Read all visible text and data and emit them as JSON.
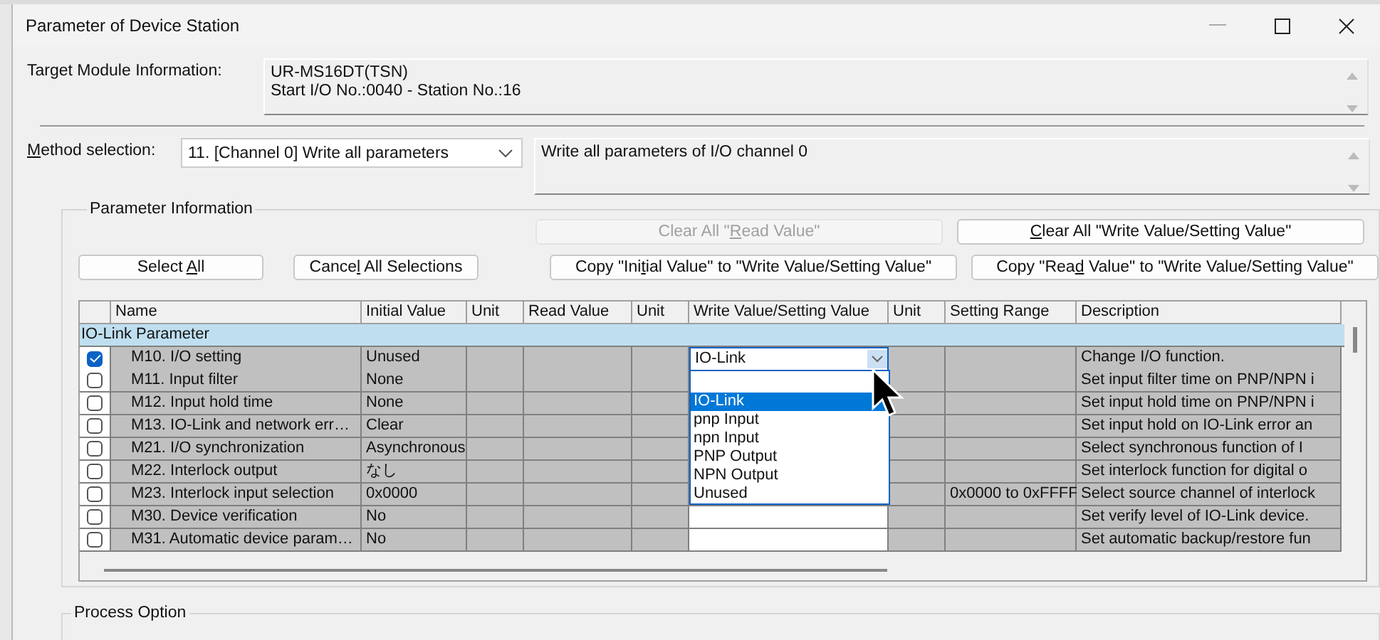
{
  "window": {
    "title": "Parameter of Device Station"
  },
  "target_module": {
    "label": "Target Module Information:",
    "lines": [
      "UR-MS16DT(TSN)",
      "Start I/O No.:0040 - Station No.:16"
    ]
  },
  "method": {
    "label_parts": [
      {
        "text": "M",
        "underlined": true
      },
      {
        "text": "ethod selection:",
        "underlined": false
      }
    ],
    "value": "11. [Channel 0] Write all parameters",
    "description": "Write all parameters of I/O channel 0"
  },
  "parameter_information": {
    "title": "Parameter Information",
    "buttons": [
      {
        "label_parts": [
          {
            "text": "Clear All \"",
            "underlined": false
          },
          {
            "text": "R",
            "underlined": true
          },
          {
            "text": "ead Value\"",
            "underlined": false
          }
        ],
        "disabled": true
      },
      {
        "label_parts": [
          {
            "text": "C",
            "underlined": true
          },
          {
            "text": "lear All \"Write Value/Setting Value\"",
            "underlined": false
          }
        ],
        "disabled": false
      },
      {
        "label_parts": [
          {
            "text": "Select ",
            "underlined": false
          },
          {
            "text": "A",
            "underlined": true
          },
          {
            "text": "ll",
            "underlined": false
          }
        ],
        "disabled": false
      },
      {
        "label_parts": [
          {
            "text": "Cance",
            "underlined": false
          },
          {
            "text": "l",
            "underlined": true
          },
          {
            "text": " All Selections",
            "underlined": false
          }
        ],
        "disabled": false
      },
      {
        "label_parts": [
          {
            "text": "Copy \"Ini",
            "underlined": false
          },
          {
            "text": "t",
            "underlined": true
          },
          {
            "text": "ial Value\" to \"Write Value/Setting Value\"",
            "underlined": false
          }
        ],
        "disabled": false
      },
      {
        "label_parts": [
          {
            "text": "Copy \"Rea",
            "underlined": false
          },
          {
            "text": "d",
            "underlined": true
          },
          {
            "text": " Value\" to \"Write Value/Setting Value\"",
            "underlined": false
          }
        ],
        "disabled": false
      }
    ],
    "table": {
      "columns": [
        "Name",
        "Initial Value",
        "Unit",
        "Read Value",
        "Unit",
        "Write Value/Setting Value",
        "Unit",
        "Setting Range",
        "Description"
      ],
      "group": "IO-Link Parameter",
      "rows": [
        {
          "checked": true,
          "name": "M10. I/O setting",
          "initial_value": "Unused",
          "write_value": "IO-Link",
          "description": "Change I/O function."
        },
        {
          "checked": false,
          "name": "M11. Input filter",
          "initial_value": "None",
          "description": "Set input filter time on PNP/NPN i"
        },
        {
          "checked": false,
          "name": "M12. Input hold time",
          "initial_value": "None",
          "description": "Set input hold time on PNP/NPN i"
        },
        {
          "checked": false,
          "name": "M13. IO-Link and network err…",
          "initial_value": "Clear",
          "description": "Set input hold on IO-Link error an"
        },
        {
          "checked": false,
          "name": "M21. I/O synchronization",
          "initial_value": "Asynchronous",
          "description": "Select synchronous function of I"
        },
        {
          "checked": false,
          "name": "M22. Interlock output",
          "initial_value": "なし",
          "description": "Set interlock function for digital o"
        },
        {
          "checked": false,
          "name": "M23. Interlock input selection",
          "initial_value": "0x0000",
          "setting_range": "0x0000 to 0xFFFF",
          "description": "Select source channel of interlock"
        },
        {
          "checked": false,
          "name": "M30. Device verification",
          "initial_value": "No",
          "description": "Set verify level of IO-Link device."
        },
        {
          "checked": false,
          "name": "M31. Automatic device param…",
          "initial_value": "No",
          "description": "Set automatic backup/restore fun"
        }
      ],
      "dropdown": {
        "items": [
          {
            "label": "IO-Link",
            "selected": true
          },
          {
            "label": "pnp Input",
            "selected": false
          },
          {
            "label": "npn Input",
            "selected": false
          },
          {
            "label": "PNP Output",
            "selected": false
          },
          {
            "label": "NPN Output",
            "selected": false
          },
          {
            "label": "Unused",
            "selected": false
          }
        ]
      }
    }
  },
  "process_option": {
    "title": "Process Option"
  }
}
